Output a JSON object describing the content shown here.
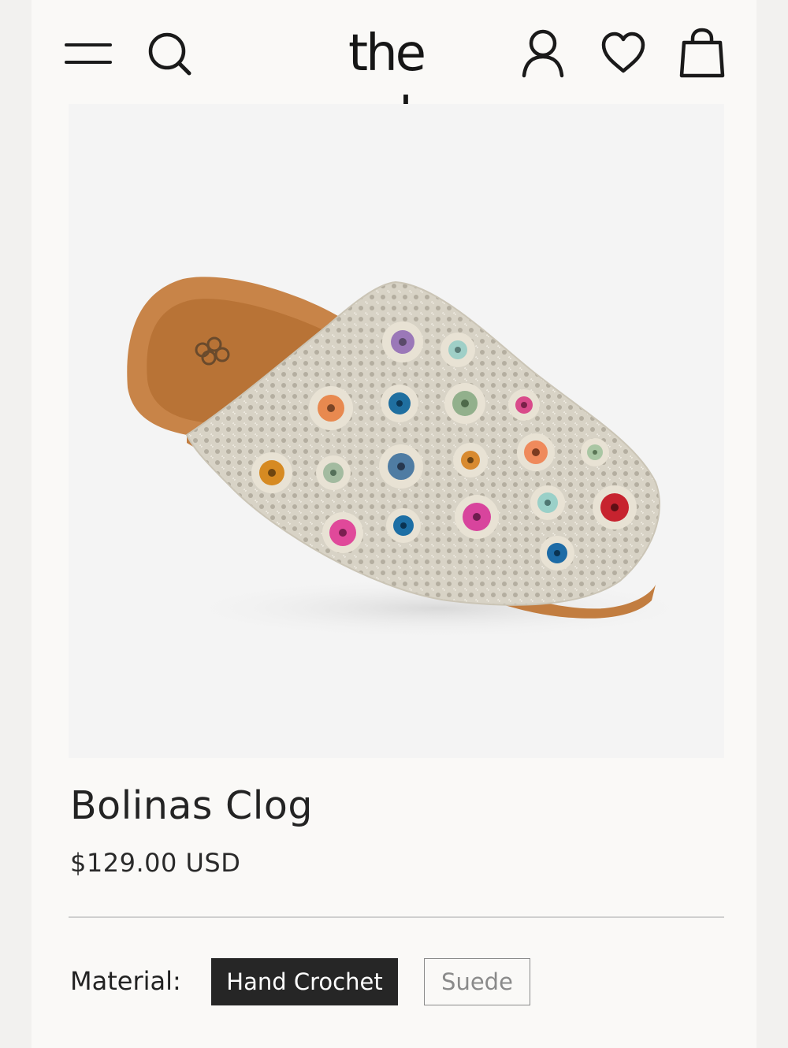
{
  "header": {
    "logo_text": "the sak",
    "icons": [
      "menu-icon",
      "search-icon",
      "account-icon",
      "wishlist-heart-icon",
      "shopping-bag-icon"
    ]
  },
  "product": {
    "name": "Bolinas Clog",
    "price": "$129.00 USD",
    "image_alt": "Bolinas Clog in Hand Crochet"
  },
  "options": {
    "material_label": "Material:",
    "materials": [
      {
        "label": "Hand Crochet",
        "selected": true
      },
      {
        "label": "Suede",
        "selected": false
      }
    ]
  },
  "colors": {
    "accent": "#262626",
    "background": "#faf9f7",
    "image_background": "#f4f4f4",
    "divider": "#cfcfcf"
  }
}
